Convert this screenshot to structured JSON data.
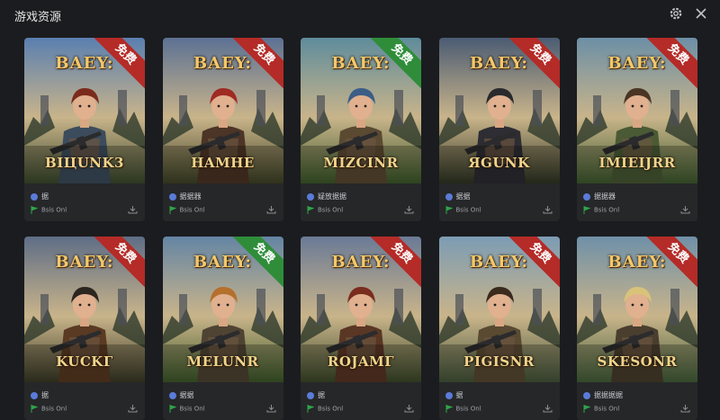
{
  "window": {
    "title": "游戏资源"
  },
  "icons": {
    "settings": "gear-icon",
    "close": "close-icon",
    "download": "download-icon",
    "platform": "platform-dot-icon",
    "status": "green-flag-icon"
  },
  "colors": {
    "ribbon_red": "#b42b27",
    "ribbon_green": "#2f8d3a",
    "background": "#1b1c1f"
  },
  "logo_text": "BAEY:",
  "cards": [
    {
      "hero": "BIЦUNK3",
      "badge": "免费",
      "badge_color": "#b42b27",
      "line1": "据",
      "line2": "Bsis Onl",
      "sky": "#5a7fb0",
      "ground": "#3b4a2c",
      "outfit": "#3c4c5c",
      "hair": "#7b2b1c"
    },
    {
      "hero": "HAMHE",
      "badge": "免费",
      "badge_color": "#b42b27",
      "line1": "据据器",
      "line2": "Bsis Onl",
      "sky": "#5c7194",
      "ground": "#3f4326",
      "outfit": "#4c3426",
      "hair": "#a02a24"
    },
    {
      "hero": "MIZCINR",
      "badge": "免费",
      "badge_color": "#2f8d3a",
      "line1": "疑放据据",
      "line2": "Bsis Onl",
      "sky": "#5e8c9c",
      "ground": "#3d5a2a",
      "outfit": "#5b4a32",
      "hair": "#3c5e86"
    },
    {
      "hero": "ЯGUNK",
      "badge": "免费",
      "badge_color": "#b42b27",
      "line1": "据据",
      "line2": "Bsis Onl",
      "sky": "#4b5b73",
      "ground": "#2f3523",
      "outfit": "#2d2d33",
      "hair": "#2a2a2e"
    },
    {
      "hero": "IMIEIJRR",
      "badge": "免费",
      "badge_color": "#b42b27",
      "line1": "据据器",
      "line2": "Bsis Onl",
      "sky": "#6c8fa6",
      "ground": "#3f5c2f",
      "outfit": "#4a5a34",
      "hair": "#4a3524"
    },
    {
      "hero": "KUCKГ",
      "badge": "免费",
      "badge_color": "#b42b27",
      "line1": "据",
      "line2": "Bsis Onl",
      "sky": "#5e6d86",
      "ground": "#3a3a26",
      "outfit": "#5a3a22",
      "hair": "#2c2620"
    },
    {
      "hero": "MELUNR",
      "badge": "免费",
      "badge_color": "#2f8d3a",
      "line1": "据据",
      "line2": "Bsis Onl",
      "sky": "#6485a4",
      "ground": "#3e5a2a",
      "outfit": "#4f4433",
      "hair": "#b4702c"
    },
    {
      "hero": "ROJAMГ",
      "badge": "免费",
      "badge_color": "#b42b27",
      "line1": "据",
      "line2": "Bsis Onl",
      "sky": "#6a7a96",
      "ground": "#3c4a2a",
      "outfit": "#5a3624",
      "hair": "#7a2c1e"
    },
    {
      "hero": "PIGISNR",
      "badge": "免费",
      "badge_color": "#b42b27",
      "line1": "据",
      "line2": "Bsis Onl",
      "sky": "#7c9cb4",
      "ground": "#45563a",
      "outfit": "#5a4a32",
      "hair": "#3a2a1e"
    },
    {
      "hero": "SKESONR",
      "badge": "免费",
      "badge_color": "#b42b27",
      "line1": "据据据据",
      "line2": "Bsis Onl",
      "sky": "#6f90a8",
      "ground": "#44603a",
      "outfit": "#4a3e2e",
      "hair": "#d9c27a"
    }
  ]
}
